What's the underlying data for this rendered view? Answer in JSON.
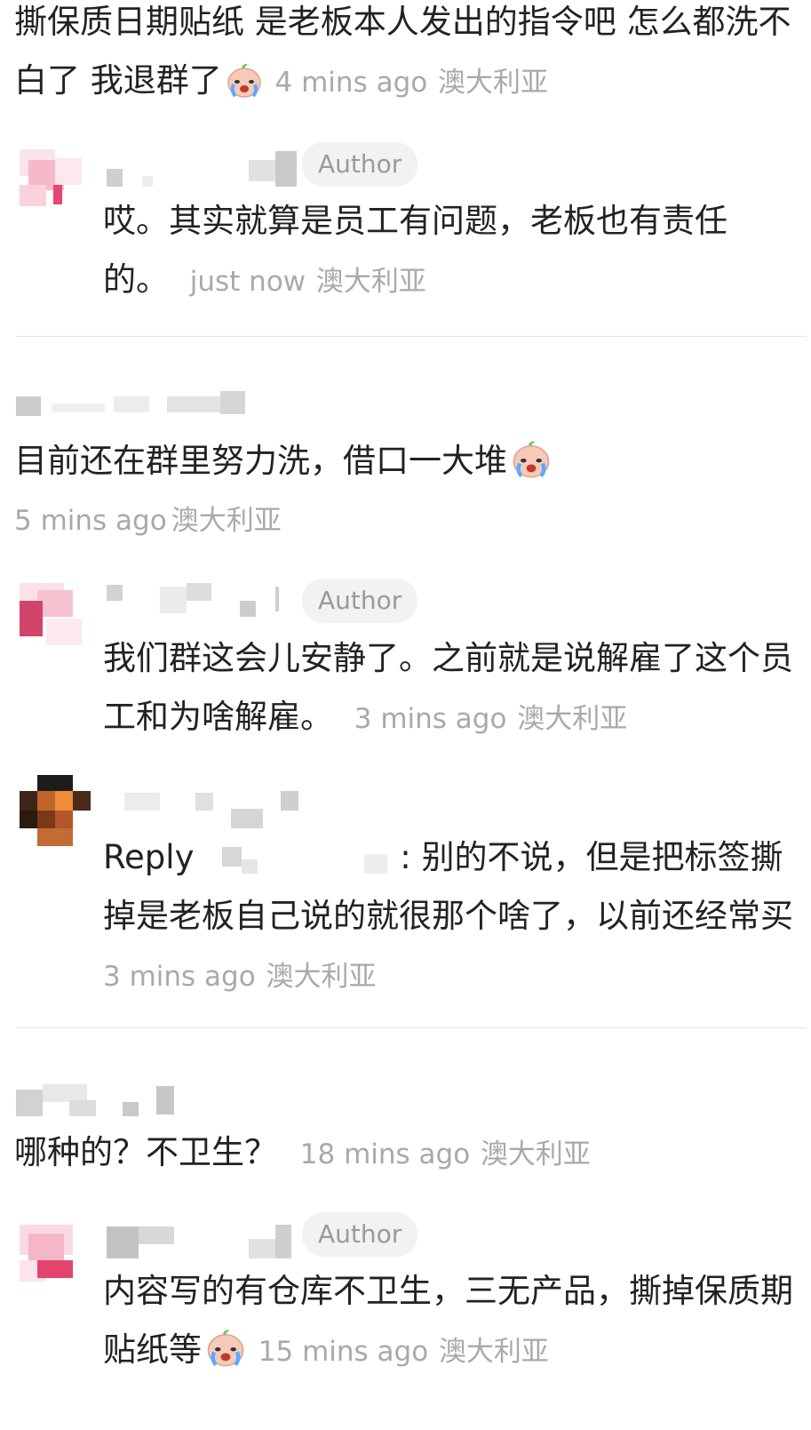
{
  "comments": [
    {
      "text": "撕保质日期贴纸 是老板本人发出的指令吧 怎么都洗不白了 我退群了",
      "emoji": "crying-face-emoji",
      "time": "4 mins ago",
      "location": "澳大利亚",
      "replies": [
        {
          "badge": "Author",
          "text": "哎。其实就算是员工有问题，老板也有责任的。",
          "time": "just now",
          "location": "澳大利亚"
        }
      ]
    },
    {
      "text": "目前还在群里努力洗，借口一大堆",
      "emoji": "crying-face-emoji",
      "time": "5 mins ago",
      "location": "澳大利亚",
      "replies": [
        {
          "badge": "Author",
          "text": "我们群这会儿安静了。之前就是说解雇了这个员工和为啥解雇。",
          "time": "3 mins ago",
          "location": "澳大利亚"
        },
        {
          "reply_prefix": "Reply",
          "text": ": 别的不说，但是把标签撕掉是老板自己说的就很那个啥了，以前还经常买",
          "time": "3 mins ago",
          "location": "澳大利亚"
        }
      ]
    },
    {
      "text": "哪种的？不卫生？",
      "time": "18 mins ago",
      "location": "澳大利亚",
      "replies": [
        {
          "badge": "Author",
          "text": "内容写的有仓库不卫生，三无产品，撕掉保质期贴纸等",
          "emoji": "crying-face-emoji",
          "time": "15 mins ago",
          "location": "澳大利亚"
        }
      ]
    }
  ],
  "colors": {
    "text": "#222222",
    "meta": "#a9a9a9",
    "badge_bg": "#f2f2f2",
    "badge_text": "#9a9a9a",
    "divider": "#e6e6e6"
  }
}
